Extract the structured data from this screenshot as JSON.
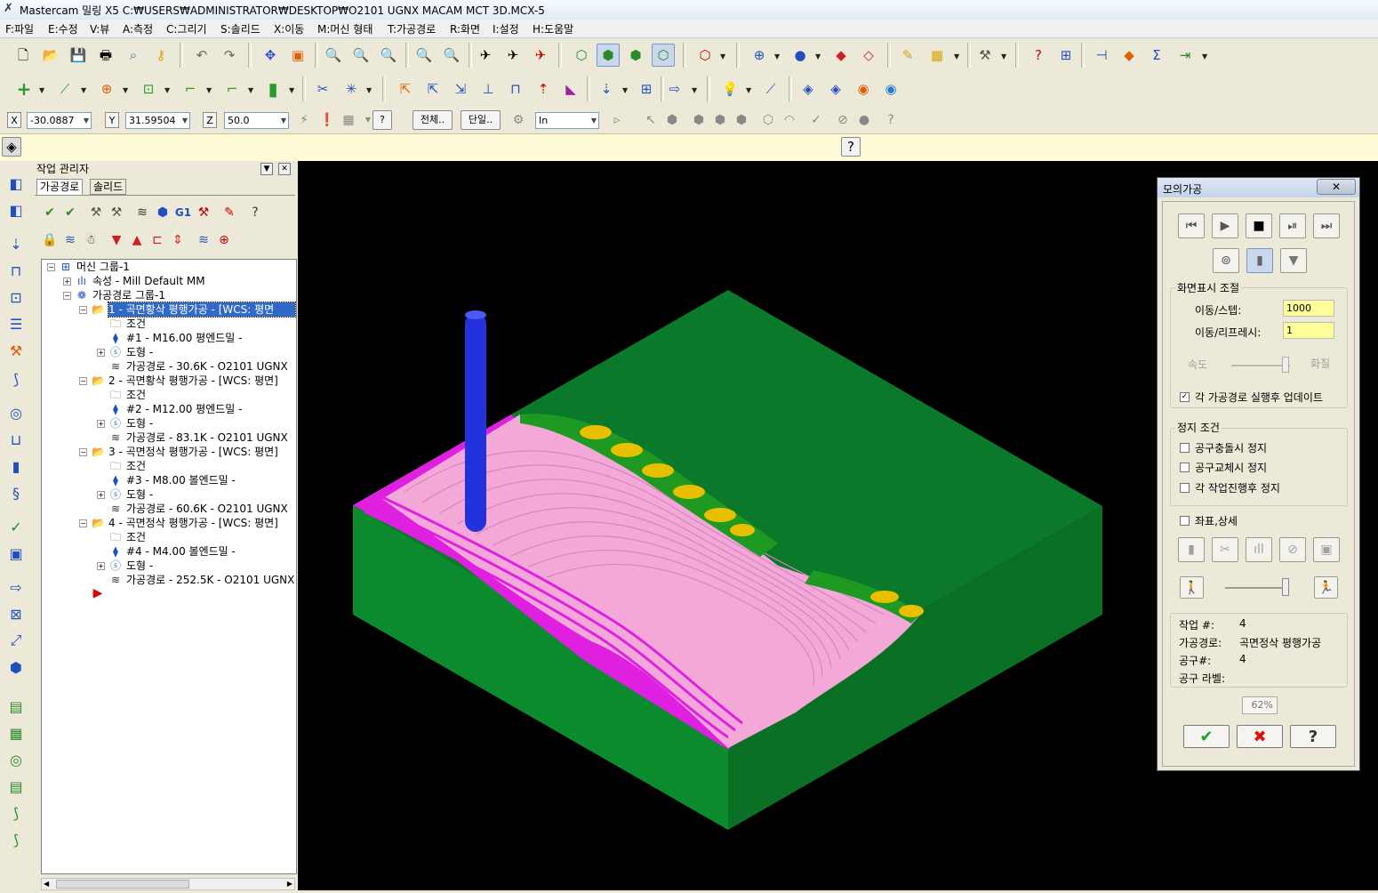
{
  "window": {
    "title": "Mastercam 밀링 X5   C:₩USERS₩ADMINISTRATOR₩DESKTOP₩O2101 UGNX MACAM MCT 3D.MCX-5",
    "app_icon": "mastercam-x-icon"
  },
  "menu": [
    {
      "label": "F:파일"
    },
    {
      "label": "E:수정"
    },
    {
      "label": "V:뷰"
    },
    {
      "label": "A:측정"
    },
    {
      "label": "C:그리기"
    },
    {
      "label": "S:솔리드"
    },
    {
      "label": "X:이동"
    },
    {
      "label": "M:머신 형태"
    },
    {
      "label": "T:가공경로"
    },
    {
      "label": "R:화면"
    },
    {
      "label": "I:설정"
    },
    {
      "label": "H:도움말"
    }
  ],
  "coords": {
    "x_label": "X",
    "x_value": "-30.0887",
    "y_label": "Y",
    "y_value": "31.59504",
    "z_label": "Z",
    "z_value": "50.0",
    "all_button": "전체..",
    "single_button": "단일..",
    "unit_value": "In"
  },
  "op_manager": {
    "title": "작업 관리자",
    "tabs": [
      {
        "label": "가공경로"
      },
      {
        "label": "솔리드"
      }
    ],
    "tree": {
      "machine_group": "머신 그룹-1",
      "properties": "속성 - Mill Default MM",
      "toolpath_group": "가공경로 그룹-1",
      "operations": [
        {
          "title": "1 - 곡면황삭 평행가공 - [WCS: 평면",
          "params": "조건",
          "tool": "#1 - M16.00 평엔드밀 -",
          "geometry": "도형 -",
          "toolpath": "가공경로 - 30.6K - O2101 UGNX"
        },
        {
          "title": "2 - 곡면황삭 평행가공 - [WCS: 평면]",
          "params": "조건",
          "tool": "#2 - M12.00 평엔드밀 -",
          "geometry": "도형 -",
          "toolpath": "가공경로 - 83.1K - O2101 UGNX"
        },
        {
          "title": "3 - 곡면정삭 평행가공 - [WCS: 평면]",
          "params": "조건",
          "tool": "#3 - M8.00 볼엔드밀 -",
          "geometry": "도형 -",
          "toolpath": "가공경로 - 60.6K - O2101 UGNX"
        },
        {
          "title": "4 - 곡면정삭 평행가공 - [WCS: 평면]",
          "params": "조건",
          "tool": "#4 - M4.00 볼엔드밀 -",
          "geometry": "도형 -",
          "toolpath": "가공경로 - 252.5K - O2101 UGNX"
        }
      ]
    }
  },
  "sim": {
    "title": "모의가공",
    "close": "✕",
    "display_group": "화면표시 조절",
    "step_label": "이동/스텝:",
    "step_value": "1000",
    "refresh_label": "이동/리프레시:",
    "refresh_value": "1",
    "speed_label": "속도",
    "quality_label": "화질",
    "update_label": "각 가공경로 실행후 업데이트",
    "update_checked": true,
    "stop_group": "정지 조건",
    "stop_collision": "공구충돌시 정지",
    "stop_toolchange": "공구교체시 정지",
    "stop_each_op": "각 작업진행후  정지",
    "coords_detail": "좌표,상세",
    "op_num_label": "작업 #:",
    "op_num_value": "4",
    "toolpath_label": "가공경로:",
    "toolpath_value": "곡면정삭 평행가공",
    "tool_num_label": "공구#:",
    "tool_num_value": "4",
    "tool_label_label": "공구 라벨:",
    "progress": "62%"
  },
  "colors": {
    "stock": "#0a7a2a",
    "surface_pink": "#f4a8d8",
    "surface_magenta": "#e020e0",
    "tool": "#2233dd",
    "uncut_gold": "#e8c000",
    "uncut_green": "#1e9a22",
    "highlight": "#3169c6",
    "viewport_bg": "#000000"
  }
}
